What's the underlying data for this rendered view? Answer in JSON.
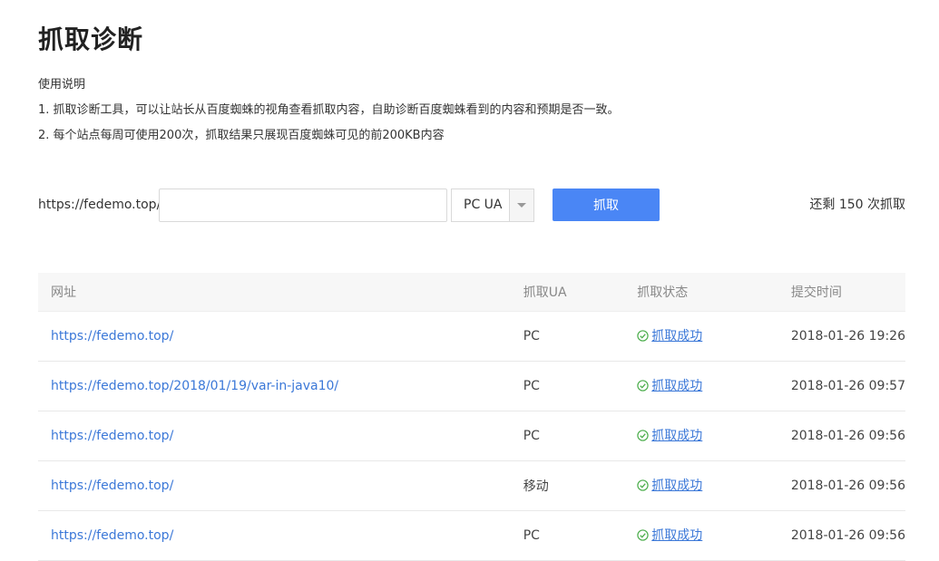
{
  "page": {
    "title": "抓取诊断"
  },
  "instructions": {
    "heading": "使用说明",
    "items": [
      "1. 抓取诊断工具，可以让站长从百度蜘蛛的视角查看抓取内容，自助诊断百度蜘蛛看到的内容和预期是否一致。",
      "2. 每个站点每周可使用200次，抓取结果只展现百度蜘蛛可见的前200KB内容"
    ]
  },
  "form": {
    "url_prefix": "https://fedemo.top/",
    "url_value": "",
    "ua_selected": "PC UA",
    "fetch_label": "抓取",
    "remaining_text": "还剩 150 次抓取"
  },
  "table": {
    "headers": [
      "网址",
      "抓取UA",
      "抓取状态",
      "提交时间"
    ],
    "rows": [
      {
        "url": "https://fedemo.top/",
        "ua": "PC",
        "status": "抓取成功",
        "time": "2018-01-26 19:26"
      },
      {
        "url": "https://fedemo.top/2018/01/19/var-in-java10/",
        "ua": "PC",
        "status": "抓取成功",
        "time": "2018-01-26 09:57"
      },
      {
        "url": "https://fedemo.top/",
        "ua": "PC",
        "status": "抓取成功",
        "time": "2018-01-26 09:56"
      },
      {
        "url": "https://fedemo.top/",
        "ua": "移动",
        "status": "抓取成功",
        "time": "2018-01-26 09:56"
      },
      {
        "url": "https://fedemo.top/",
        "ua": "PC",
        "status": "抓取成功",
        "time": "2018-01-26 09:56"
      }
    ]
  },
  "icons": {
    "status_success": "check-circle-icon",
    "select_arrow": "chevron-down-icon"
  },
  "colors": {
    "accent": "#4a86f5",
    "link": "#3b78d8",
    "success_icon": "#4cae4c",
    "header_bg": "#f7f7f7"
  }
}
